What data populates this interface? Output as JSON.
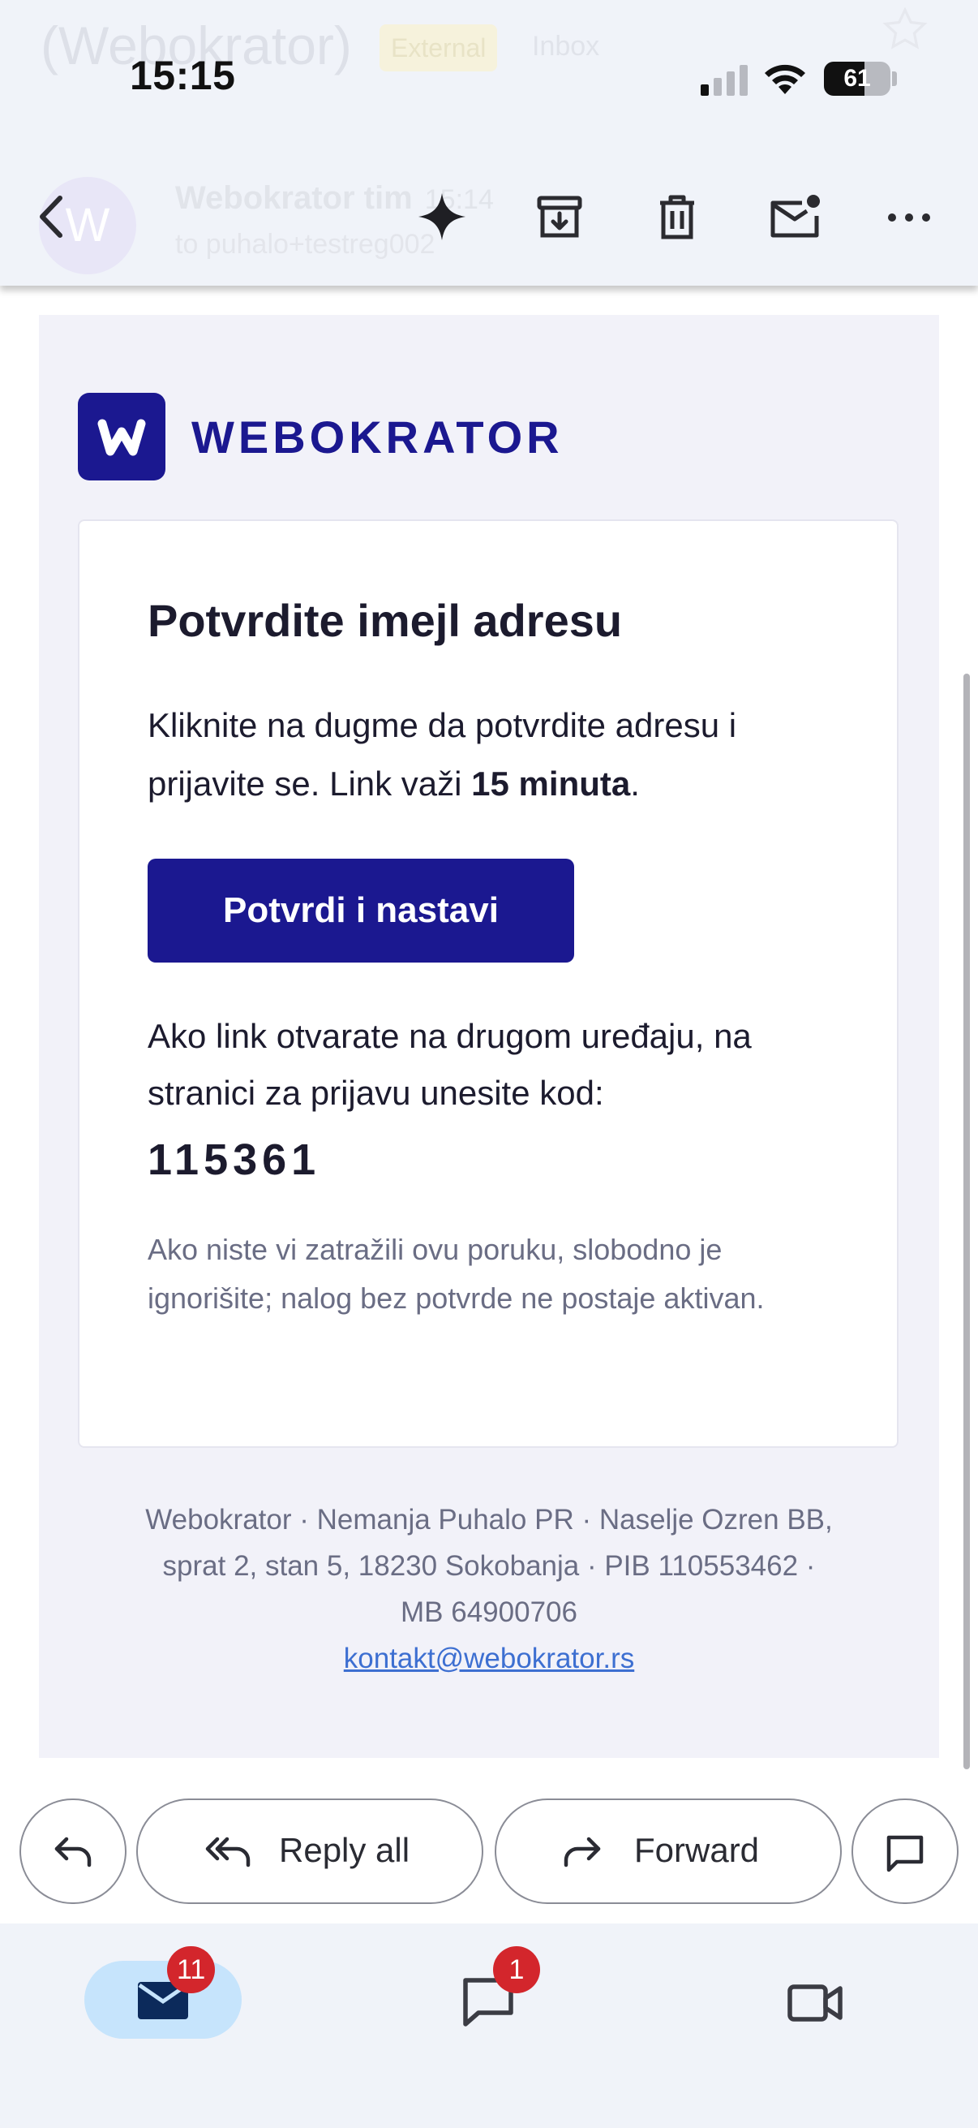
{
  "status_bar": {
    "time": "15:15",
    "battery": "61"
  },
  "background_header": {
    "subject_fragment": "(Webokrator)",
    "badge_external": "External",
    "label_inbox": "Inbox",
    "avatar_letter": "W",
    "sender": "Webokrator tim",
    "time": "15:14",
    "recipient": "to puhalo+testreg002"
  },
  "toolbar": {
    "icons": [
      "back-arrow-icon",
      "sparkle-icon",
      "archive-icon",
      "trash-icon",
      "mark-unread-icon",
      "more-icon"
    ]
  },
  "email": {
    "logo_letter": "w",
    "brand": "WEBOKRATOR",
    "title": "Potvrdite imejl adresu",
    "para1_prefix": "Kliknite na dugme da potvrdite adresu i prijavite se. Link važi ",
    "para1_bold": "15 minuta",
    "para1_suffix": ".",
    "button_label": "Potvrdi i nastavi",
    "para2": "Ako link otvarate na drugom uređaju, na stranici za prijavu unesite kod:",
    "code": "115361",
    "note": "Ako niste vi zatražili ovu poruku, slobodno je ignorišite; nalog bez potvrde ne postaje aktivan.",
    "footer_line1": "Webokrator · Nemanja Puhalo PR · Naselje Ozren BB,",
    "footer_line2": "sprat 2, stan 5, 18230 Sokobanja · PIB 110553462 ·",
    "footer_line3": "MB 64900706",
    "footer_email": "kontakt@webokrator.rs"
  },
  "actions": {
    "reply_all": "Reply all",
    "forward": "Forward"
  },
  "bottom_nav": {
    "mail_badge": "11",
    "chat_badge": "1"
  },
  "colors": {
    "brand": "#1b1890",
    "badge_red": "#d3262c",
    "nav_active": "#c6e4fc",
    "link": "#3d6fd1"
  }
}
